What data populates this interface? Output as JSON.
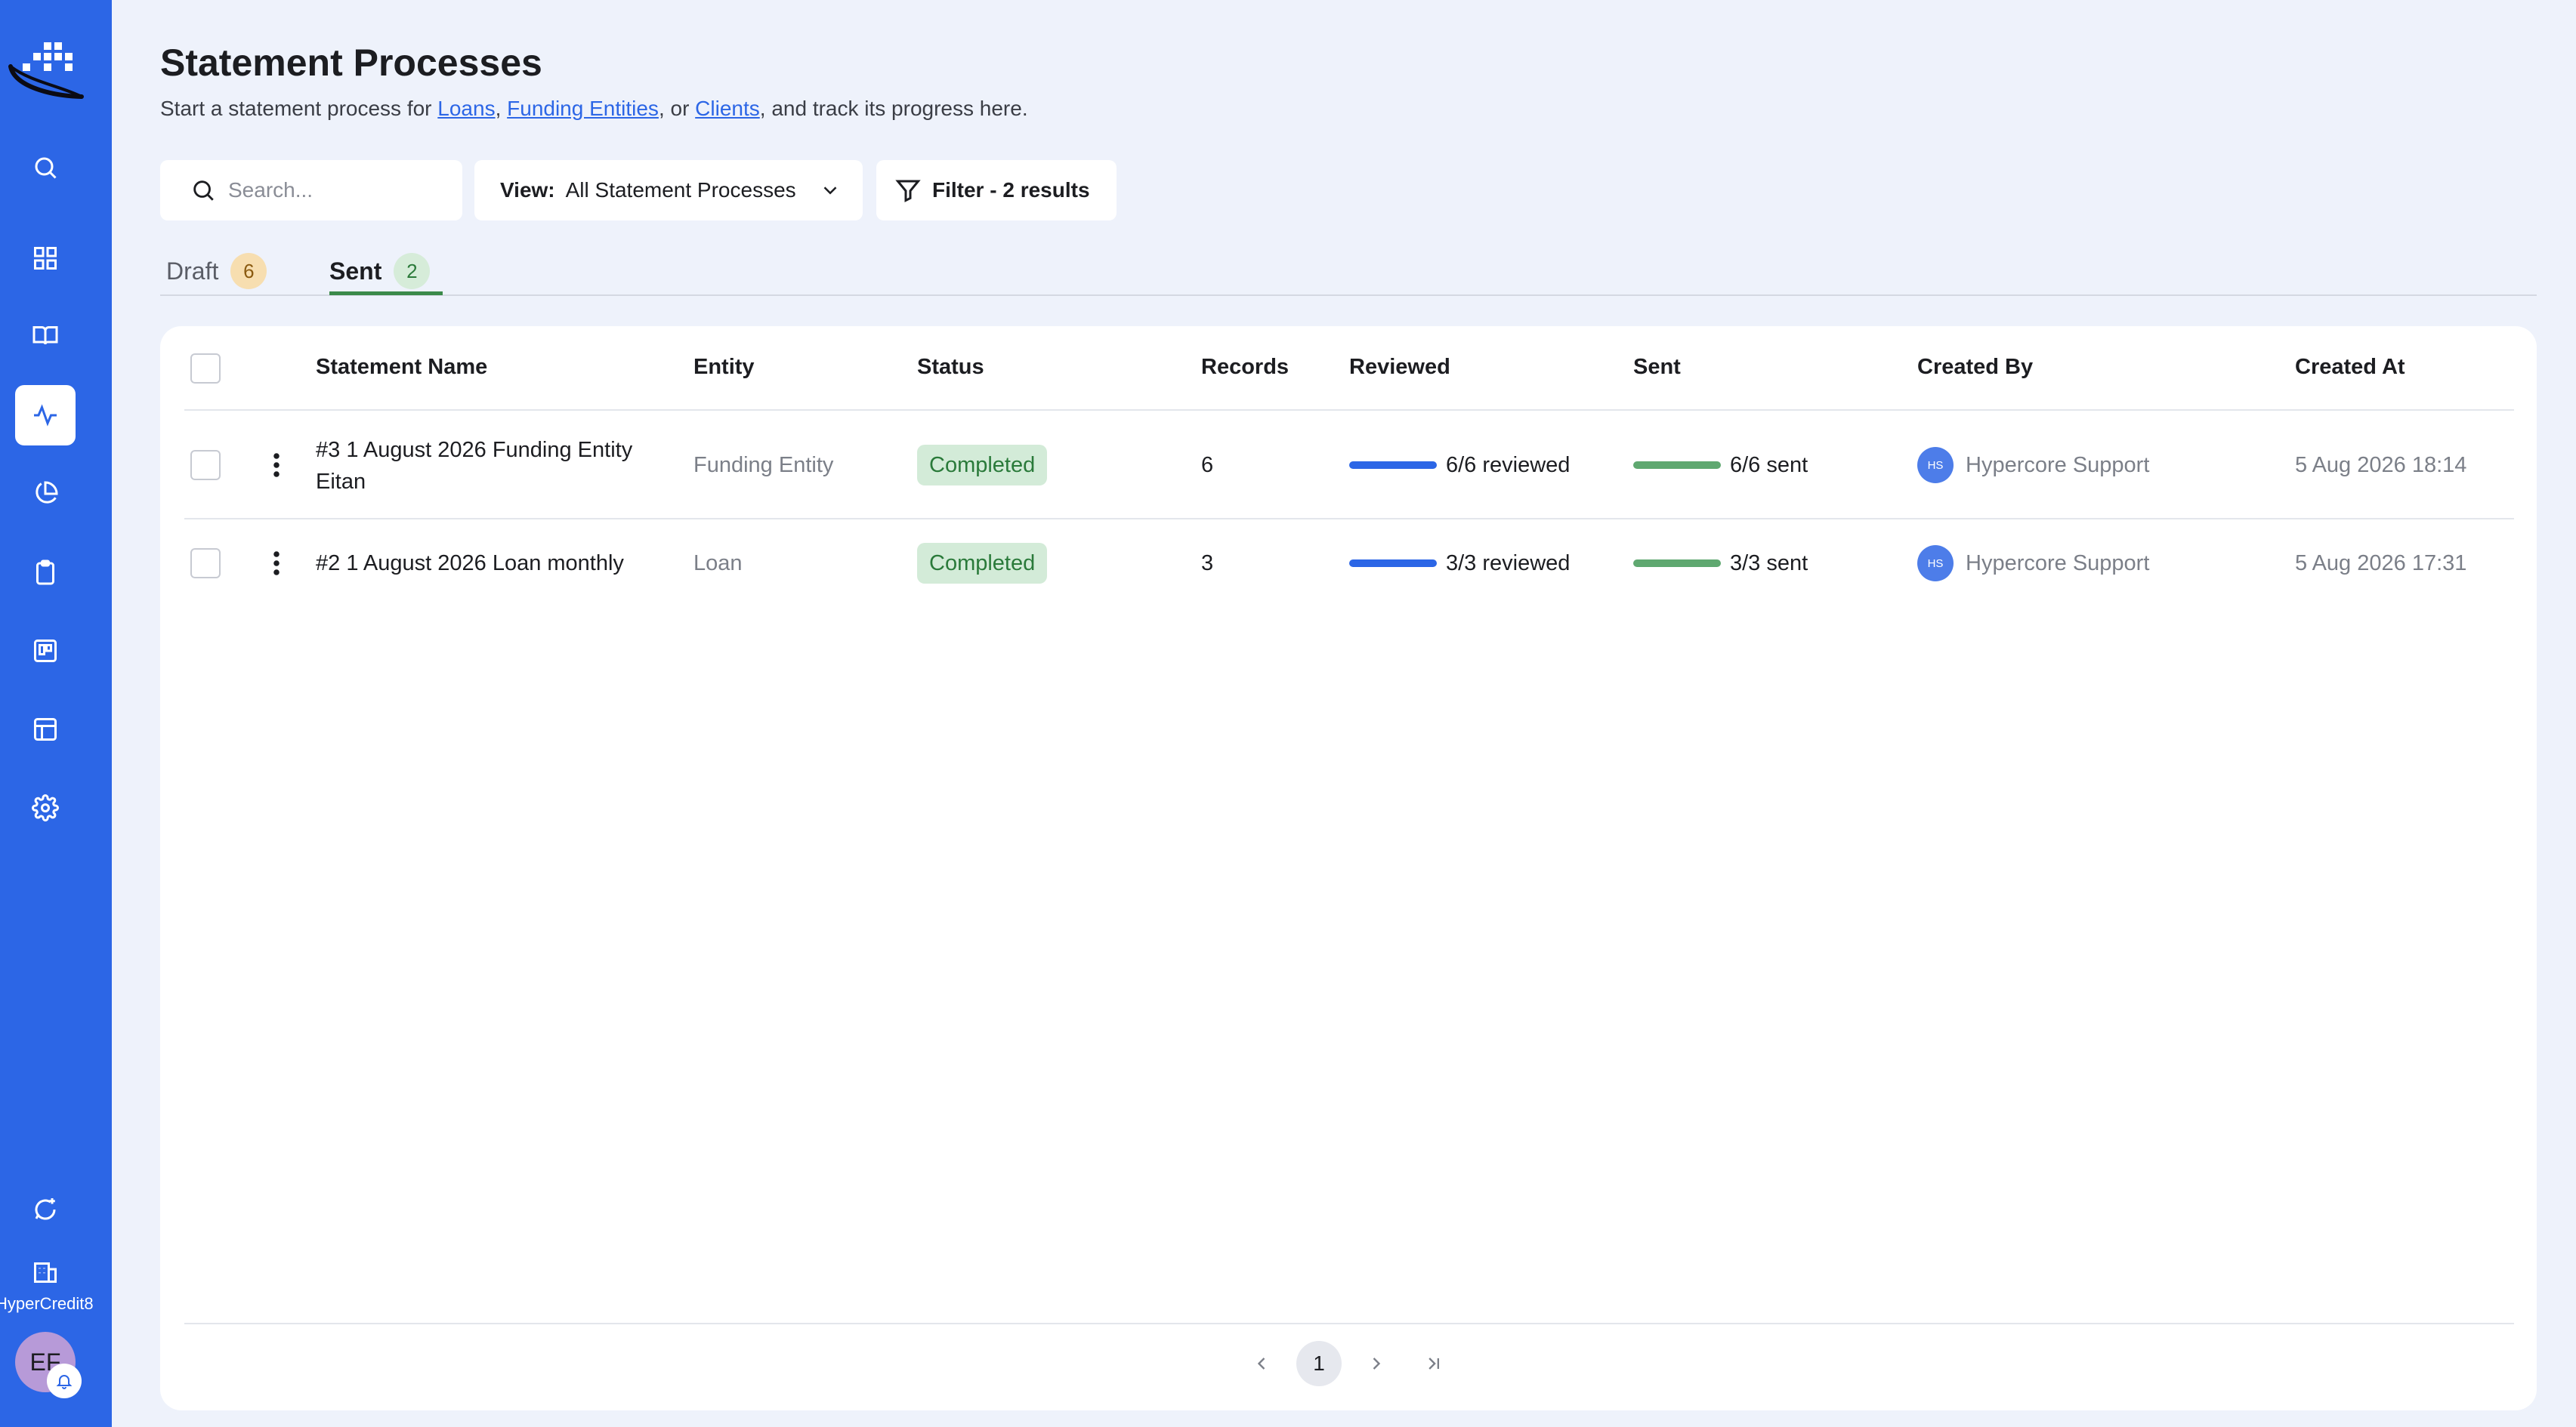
{
  "app": {
    "org_name": "HyperCredit8",
    "user_initials": "EF"
  },
  "page": {
    "title": "Statement Processes",
    "subtitle_prefix": "Start a statement process for ",
    "subtitle_link_loans": "Loans",
    "subtitle_sep1": ", ",
    "subtitle_link_funding": "Funding Entities",
    "subtitle_sep2": ", or ",
    "subtitle_link_clients": "Clients",
    "subtitle_suffix": ", and track its progress here."
  },
  "toolbar": {
    "search_placeholder": "Search...",
    "view_label": "View:",
    "view_value": "All Statement Processes",
    "filter_label": "Filter - 2 results"
  },
  "tabs": [
    {
      "label": "Draft",
      "count": "6"
    },
    {
      "label": "Sent",
      "count": "2"
    }
  ],
  "table": {
    "columns": [
      "Statement Name",
      "Entity",
      "Status",
      "Records",
      "Reviewed",
      "Sent",
      "Created By",
      "Created At"
    ],
    "rows": [
      {
        "name_line1": "#3 1 August 2026 Funding Entity",
        "name_line2": "Eitan",
        "entity": "Funding Entity",
        "status": "Completed",
        "records": "6",
        "reviewed": "6/6 reviewed",
        "reviewed_fraction": 1.0,
        "sent": "6/6 sent",
        "sent_fraction": 1.0,
        "created_by_initials": "HS",
        "created_by": "Hypercore Support",
        "created_at": "5 Aug 2026 18:14"
      },
      {
        "name_line1": "#2 1 August 2026 Loan monthly",
        "name_line2": "",
        "entity": "Loan",
        "status": "Completed",
        "records": "3",
        "reviewed": "3/3 reviewed",
        "reviewed_fraction": 1.0,
        "sent": "3/3 sent",
        "sent_fraction": 1.0,
        "created_by_initials": "HS",
        "created_by": "Hypercore Support",
        "created_at": "5 Aug 2026 17:31"
      }
    ]
  },
  "pagination": {
    "current_page": "1"
  },
  "colors": {
    "sidebar": "#2c66e6",
    "reviewed_bar": "#2c66e6",
    "sent_bar": "#5fa870",
    "status_completed_bg": "#d3ebd8"
  },
  "icons": {
    "sidebar": [
      "search-icon",
      "dashboard-icon",
      "book-icon",
      "activity-icon",
      "pie-chart-icon",
      "clipboard-icon",
      "kanban-icon",
      "table-icon",
      "settings-icon"
    ],
    "sidebar_bottom": [
      "support-chat-icon",
      "building-icon"
    ]
  }
}
